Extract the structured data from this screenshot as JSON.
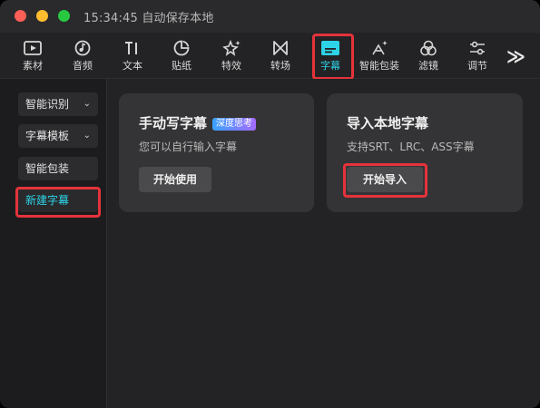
{
  "window": {
    "title": "15:34:45 自动保存本地"
  },
  "toolbar": {
    "items": [
      {
        "label": "素材",
        "icon": "media-play-icon"
      },
      {
        "label": "音频",
        "icon": "music-note-icon"
      },
      {
        "label": "文本",
        "icon": "text-icon"
      },
      {
        "label": "贴纸",
        "icon": "sticker-icon"
      },
      {
        "label": "特效",
        "icon": "sparkle-star-icon"
      },
      {
        "label": "转场",
        "icon": "transition-bowtie-icon"
      },
      {
        "label": "字幕",
        "icon": "subtitle-icon",
        "active": true
      },
      {
        "label": "智能包装",
        "icon": "smart-pack-icon"
      },
      {
        "label": "滤镜",
        "icon": "filter-circles-icon"
      },
      {
        "label": "调节",
        "icon": "adjust-sliders-icon"
      }
    ],
    "more": "≫"
  },
  "sidebar": {
    "items": [
      {
        "label": "智能识别",
        "dropdown": true
      },
      {
        "label": "字幕模板",
        "dropdown": true
      },
      {
        "label": "智能包装",
        "dropdown": false
      },
      {
        "label": "新建字幕",
        "dropdown": false,
        "active": true
      }
    ]
  },
  "cards": [
    {
      "title": "手动写字幕",
      "badge": "深度思考",
      "desc": "您可以自行输入字幕",
      "button": "开始使用"
    },
    {
      "title": "导入本地字幕",
      "desc": "支持SRT、LRC、ASS字幕",
      "button": "开始导入"
    }
  ],
  "colors": {
    "accent": "#2dd4e8",
    "highlight": "#e5333b"
  }
}
